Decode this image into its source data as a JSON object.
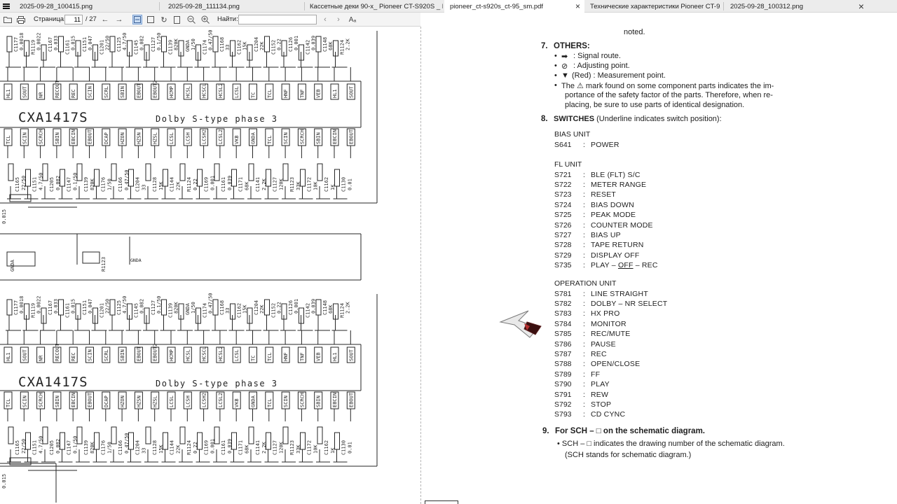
{
  "tabs": [
    {
      "label": "2025-09-28_100415.png",
      "active": false
    },
    {
      "label": "2025-09-28_111134.png",
      "active": false
    },
    {
      "label": "Кассетные деки 90-х_ Pioneer CT-S920S _ Pr...",
      "active": false
    },
    {
      "label": "pioneer_ct-s920s_ct-95_sm.pdf",
      "active": true
    },
    {
      "label": "Технические характеристики Pioneer CT-92...",
      "active": false
    },
    {
      "label": "2025-09-28_100312.png",
      "active": false
    }
  ],
  "toolbar": {
    "page_label": "Страница:",
    "page_current": "11",
    "page_total": "/ 27",
    "find_label": "Найти:",
    "find_value": "",
    "text_size_icon": "Aₐ"
  },
  "schematic": {
    "chip_top": "CXA1417S",
    "phase_top": "Dolby S-type phase 3",
    "chip_bottom": "CXA1417S",
    "phase_bottom": "Dolby S-type phase 3",
    "labels": [
      "C1177",
      "R1177",
      "C1117",
      "R1119",
      "C1169",
      "C1159",
      "C1167",
      "C1165",
      "C1163",
      "C1161",
      "C1155",
      "C1153",
      "C1151",
      "C1167",
      "C1171",
      "C1201",
      "C1203",
      "C1205",
      "C1125",
      "C1141",
      "C1143",
      "C1145",
      "C1147",
      "C1129",
      "C1127",
      "C1131",
      "C1137",
      "C1139",
      "C1173",
      "R1123",
      "GNDA",
      "C1182",
      "C1176",
      "C1174",
      "C1172",
      "C1170",
      "C1168",
      "C1166",
      "C1164",
      "C1162",
      "C1160",
      "C1158",
      "C1204",
      "C1202",
      "C1130",
      "C1152",
      "C1150",
      "C1128",
      "C1126",
      "C1132",
      "C1134",
      "C1142",
      "C1144",
      "C1146",
      "C1148",
      "R1129",
      "R1128",
      "R1124"
    ],
    "pins_top": [
      "HL1",
      "SOUT",
      "NR",
      "RECOUT",
      "REC",
      "SCIN",
      "SCRL",
      "SBIN",
      "EBOUT",
      "EBOUT2",
      "HCMP",
      "HCSL",
      "HCSCL",
      "HCSL2",
      "LCSL",
      "TC",
      "TCL",
      "HNF",
      "TNF",
      "VEB"
    ],
    "pins_bottom": [
      "TCL",
      "SCIN",
      "SCRCH",
      "SBIN",
      "EBCIN",
      "EBOUT",
      "DCAP",
      "HZON",
      "HZSN",
      "HZSL",
      "LCSL",
      "LCSH",
      "LCSH2",
      "LCSL2",
      "VKB",
      "GNDA"
    ],
    "values": [
      "0.0018",
      "0.0022",
      "0.033",
      "0.015",
      "0.047",
      "22/50",
      "4.7/50",
      "0.082",
      "0.1/50",
      "820K",
      "1/50",
      "0.47/50",
      "33",
      "15K",
      "22K",
      "0.22",
      "0.001",
      "0.039",
      "68K",
      "2.2K",
      "120K",
      "33K",
      "10K",
      "1K",
      "0.01",
      "18K",
      "0.015"
    ]
  },
  "page": {
    "noted": "noted.",
    "others": {
      "number": "7.",
      "title": "OTHERS:",
      "items": [
        {
          "symbol": "➡",
          "text": ": Signal route."
        },
        {
          "symbol": "⊘",
          "text": ": Adjusting point."
        },
        {
          "symbol": "▼",
          "text": "(Red) : Measurement point."
        }
      ],
      "safety_line1": "The ⚠ mark found on some component parts indicates the im-",
      "safety_line2": "portance of the safety factor of the parts. Therefore, when re-",
      "safety_line3": "placing, be sure to use parts of identical designation."
    },
    "switches": {
      "number": "8.",
      "title_bold": "SWITCHES",
      "title_rest": " (Underline indicates switch position):",
      "groups": [
        {
          "name": "BIAS UNIT",
          "items": [
            {
              "code": "S641",
              "name": "POWER"
            }
          ]
        },
        {
          "name": "FL UNIT",
          "items": [
            {
              "code": "S721",
              "name": "BLE (FLT) S/C"
            },
            {
              "code": "S722",
              "name": "METER RANGE"
            },
            {
              "code": "S723",
              "name": "RESET"
            },
            {
              "code": "S724",
              "name": "BIAS DOWN"
            },
            {
              "code": "S725",
              "name": "PEAK MODE"
            },
            {
              "code": "S726",
              "name": "COUNTER MODE"
            },
            {
              "code": "S727",
              "name": "BIAS UP"
            },
            {
              "code": "S728",
              "name": "TAPE RETURN"
            },
            {
              "code": "S729",
              "name": "DISPLAY OFF"
            },
            {
              "code": "S735",
              "name_before": "PLAY – ",
              "name_underline": "OFF",
              "name_after": " – REC"
            }
          ]
        },
        {
          "name": "OPERATION UNIT",
          "items": [
            {
              "code": "S781",
              "name": "LINE STRAIGHT"
            },
            {
              "code": "S782",
              "name": "DOLBY – NR SELECT"
            },
            {
              "code": "S783",
              "name": "HX PRO"
            },
            {
              "code": "S784",
              "name": "MONITOR"
            },
            {
              "code": "S785",
              "name": "REC/MUTE"
            },
            {
              "code": "S786",
              "name": "PAUSE"
            },
            {
              "code": "S787",
              "name": "REC"
            },
            {
              "code": "S788",
              "name": "OPEN/CLOSE"
            },
            {
              "code": "S789",
              "name": "FF"
            },
            {
              "code": "S790",
              "name": "PLAY"
            },
            {
              "code": "S791",
              "name": "REW"
            },
            {
              "code": "S792",
              "name": "STOP"
            },
            {
              "code": "S793",
              "name": "CD CYNC"
            }
          ]
        }
      ]
    },
    "sch": {
      "number": "9.",
      "title": "For SCH – □ on the schematic diagram.",
      "line1": "• SCH – □ indicates the drawing number of the schematic diagram.",
      "line2": "(SCH stands for schematic diagram.)"
    }
  },
  "colors": {
    "tab_bg": "#ececec",
    "tab_active": "#ffffff",
    "toolbar_bg": "#f4f4f4",
    "ink": "#1e1e1e"
  }
}
